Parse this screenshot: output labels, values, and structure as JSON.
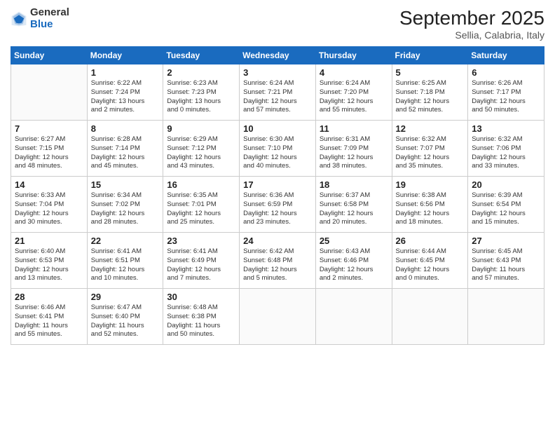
{
  "header": {
    "logo_general": "General",
    "logo_blue": "Blue",
    "month": "September 2025",
    "location": "Sellia, Calabria, Italy"
  },
  "days_of_week": [
    "Sunday",
    "Monday",
    "Tuesday",
    "Wednesday",
    "Thursday",
    "Friday",
    "Saturday"
  ],
  "weeks": [
    [
      {
        "day": "",
        "info": ""
      },
      {
        "day": "1",
        "info": "Sunrise: 6:22 AM\nSunset: 7:24 PM\nDaylight: 13 hours\nand 2 minutes."
      },
      {
        "day": "2",
        "info": "Sunrise: 6:23 AM\nSunset: 7:23 PM\nDaylight: 13 hours\nand 0 minutes."
      },
      {
        "day": "3",
        "info": "Sunrise: 6:24 AM\nSunset: 7:21 PM\nDaylight: 12 hours\nand 57 minutes."
      },
      {
        "day": "4",
        "info": "Sunrise: 6:24 AM\nSunset: 7:20 PM\nDaylight: 12 hours\nand 55 minutes."
      },
      {
        "day": "5",
        "info": "Sunrise: 6:25 AM\nSunset: 7:18 PM\nDaylight: 12 hours\nand 52 minutes."
      },
      {
        "day": "6",
        "info": "Sunrise: 6:26 AM\nSunset: 7:17 PM\nDaylight: 12 hours\nand 50 minutes."
      }
    ],
    [
      {
        "day": "7",
        "info": "Sunrise: 6:27 AM\nSunset: 7:15 PM\nDaylight: 12 hours\nand 48 minutes."
      },
      {
        "day": "8",
        "info": "Sunrise: 6:28 AM\nSunset: 7:14 PM\nDaylight: 12 hours\nand 45 minutes."
      },
      {
        "day": "9",
        "info": "Sunrise: 6:29 AM\nSunset: 7:12 PM\nDaylight: 12 hours\nand 43 minutes."
      },
      {
        "day": "10",
        "info": "Sunrise: 6:30 AM\nSunset: 7:10 PM\nDaylight: 12 hours\nand 40 minutes."
      },
      {
        "day": "11",
        "info": "Sunrise: 6:31 AM\nSunset: 7:09 PM\nDaylight: 12 hours\nand 38 minutes."
      },
      {
        "day": "12",
        "info": "Sunrise: 6:32 AM\nSunset: 7:07 PM\nDaylight: 12 hours\nand 35 minutes."
      },
      {
        "day": "13",
        "info": "Sunrise: 6:32 AM\nSunset: 7:06 PM\nDaylight: 12 hours\nand 33 minutes."
      }
    ],
    [
      {
        "day": "14",
        "info": "Sunrise: 6:33 AM\nSunset: 7:04 PM\nDaylight: 12 hours\nand 30 minutes."
      },
      {
        "day": "15",
        "info": "Sunrise: 6:34 AM\nSunset: 7:02 PM\nDaylight: 12 hours\nand 28 minutes."
      },
      {
        "day": "16",
        "info": "Sunrise: 6:35 AM\nSunset: 7:01 PM\nDaylight: 12 hours\nand 25 minutes."
      },
      {
        "day": "17",
        "info": "Sunrise: 6:36 AM\nSunset: 6:59 PM\nDaylight: 12 hours\nand 23 minutes."
      },
      {
        "day": "18",
        "info": "Sunrise: 6:37 AM\nSunset: 6:58 PM\nDaylight: 12 hours\nand 20 minutes."
      },
      {
        "day": "19",
        "info": "Sunrise: 6:38 AM\nSunset: 6:56 PM\nDaylight: 12 hours\nand 18 minutes."
      },
      {
        "day": "20",
        "info": "Sunrise: 6:39 AM\nSunset: 6:54 PM\nDaylight: 12 hours\nand 15 minutes."
      }
    ],
    [
      {
        "day": "21",
        "info": "Sunrise: 6:40 AM\nSunset: 6:53 PM\nDaylight: 12 hours\nand 13 minutes."
      },
      {
        "day": "22",
        "info": "Sunrise: 6:41 AM\nSunset: 6:51 PM\nDaylight: 12 hours\nand 10 minutes."
      },
      {
        "day": "23",
        "info": "Sunrise: 6:41 AM\nSunset: 6:49 PM\nDaylight: 12 hours\nand 7 minutes."
      },
      {
        "day": "24",
        "info": "Sunrise: 6:42 AM\nSunset: 6:48 PM\nDaylight: 12 hours\nand 5 minutes."
      },
      {
        "day": "25",
        "info": "Sunrise: 6:43 AM\nSunset: 6:46 PM\nDaylight: 12 hours\nand 2 minutes."
      },
      {
        "day": "26",
        "info": "Sunrise: 6:44 AM\nSunset: 6:45 PM\nDaylight: 12 hours\nand 0 minutes."
      },
      {
        "day": "27",
        "info": "Sunrise: 6:45 AM\nSunset: 6:43 PM\nDaylight: 11 hours\nand 57 minutes."
      }
    ],
    [
      {
        "day": "28",
        "info": "Sunrise: 6:46 AM\nSunset: 6:41 PM\nDaylight: 11 hours\nand 55 minutes."
      },
      {
        "day": "29",
        "info": "Sunrise: 6:47 AM\nSunset: 6:40 PM\nDaylight: 11 hours\nand 52 minutes."
      },
      {
        "day": "30",
        "info": "Sunrise: 6:48 AM\nSunset: 6:38 PM\nDaylight: 11 hours\nand 50 minutes."
      },
      {
        "day": "",
        "info": ""
      },
      {
        "day": "",
        "info": ""
      },
      {
        "day": "",
        "info": ""
      },
      {
        "day": "",
        "info": ""
      }
    ]
  ]
}
